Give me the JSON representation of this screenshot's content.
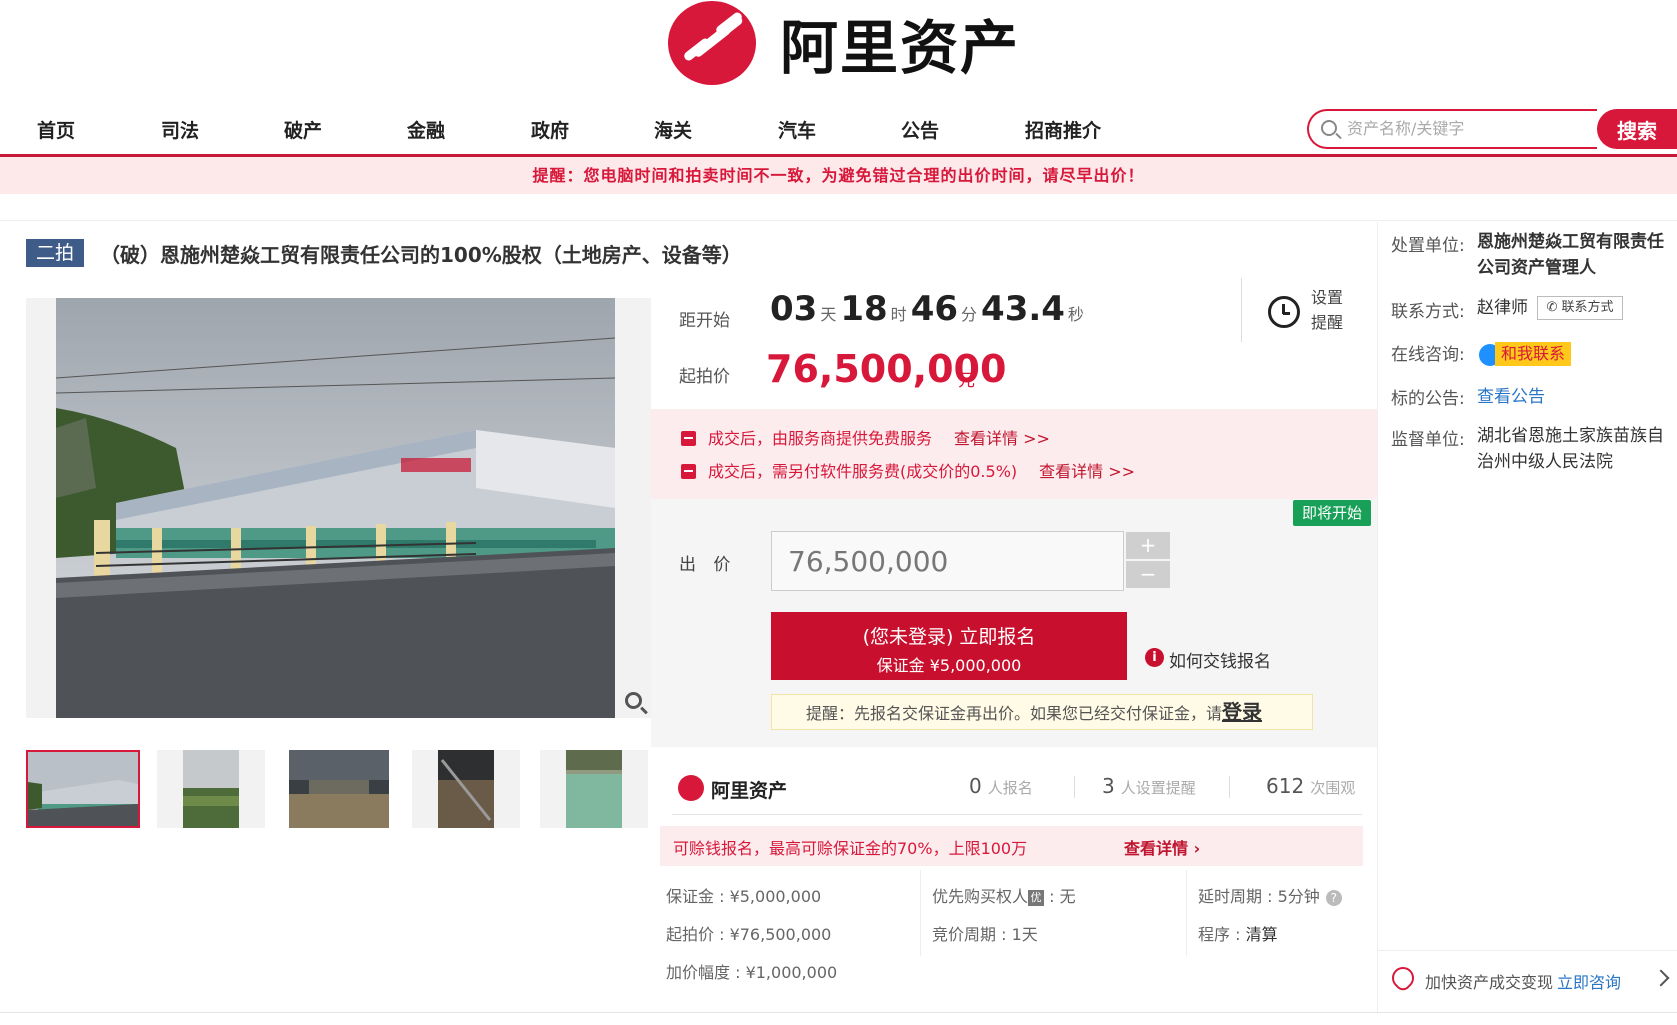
{
  "header": {
    "brand": "阿里资产",
    "nav": [
      "首页",
      "司法",
      "破产",
      "金融",
      "政府",
      "海关",
      "汽车",
      "公告",
      "招商推介"
    ],
    "search_placeholder": "资产名称/关键字",
    "search_button": "搜索",
    "notice": "提醒：您电脑时间和拍卖时间不一致，为避免错过合理的出价时间，请尽早出价！"
  },
  "item": {
    "round_badge": "二拍",
    "title": "（破）恩施州楚焱工贸有限责任公司的100%股权（土地房产、设备等）"
  },
  "countdown": {
    "label": "距开始",
    "days": "03",
    "days_unit": "天",
    "hours": "18",
    "hours_unit": "时",
    "minutes": "46",
    "minutes_unit": "分",
    "seconds": "43.4",
    "seconds_unit": "秒",
    "reminder": "设置提醒"
  },
  "price": {
    "label": "起拍价",
    "value": "76,500,000",
    "unit": "元"
  },
  "services": [
    {
      "text": "成交后，由服务商提供免费服务",
      "link": "查看详情 >>"
    },
    {
      "text": "成交后，需另付软件服务费(成交价的0.5%)",
      "link": "查看详情 >>"
    }
  ],
  "bid": {
    "status_badge": "即将开始",
    "label": "出 价",
    "value": "76,500,000",
    "plus": "+",
    "minus": "−",
    "signup_line1": "(您未登录) 立即报名",
    "signup_line2": "保证金 ¥5,000,000",
    "how_to_pay": "如何交钱报名",
    "tip": "提醒：先报名交保证金再出价。如果您已经交付保证金，请",
    "login": "登录"
  },
  "stats": {
    "brand": "阿里资产",
    "signups": "0",
    "signups_label": "人报名",
    "reminders": "3",
    "reminders_label": "人设置提醒",
    "views": "612",
    "views_label": "次围观"
  },
  "compensate": {
    "text": "可赊钱报名，最高可赊保证金的70%，上限100万",
    "link": "查看详情"
  },
  "details": {
    "deposit": "保证金 : ¥5,000,000",
    "start_price": "起拍价 : ¥76,500,000",
    "increment": "加价幅度 : ¥1,000,000",
    "priority_label": "优先购买权人",
    "priority_badge": "优",
    "priority_value": " : 无",
    "cycle": "竞价周期 : 1天",
    "delay": "延时周期 : 5分钟",
    "procedure_label": "程序 : ",
    "procedure_value": "清算"
  },
  "right_panel": {
    "unit_label": "处置单位:",
    "unit_value": "恩施州楚焱工贸有限责任公司资产管理人",
    "contact_label": "联系方式:",
    "contact_value": "赵律师",
    "contact_button": "联系方式",
    "chat_label": "在线咨询:",
    "chat_badge": "和我联系",
    "notice_label": "标的公告:",
    "notice_link": "查看公告",
    "court_label": "监督单位:",
    "court_value": "湖北省恩施土家族苗族自治州中级人民法院",
    "consult_text": "加快资产成交变现",
    "consult_link": "立即咨询"
  },
  "colors": {
    "brand_red": "#d8183a",
    "badge_blue": "#3f5c89",
    "status_green": "#18a058",
    "link_blue": "#2a76c6"
  }
}
